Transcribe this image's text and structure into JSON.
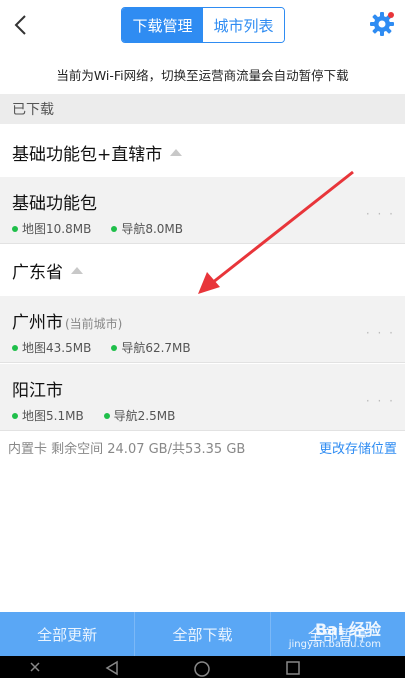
{
  "header": {
    "tabs": [
      {
        "label": "下载管理",
        "active": true
      },
      {
        "label": "城市列表",
        "active": false
      }
    ]
  },
  "notice": "当前为Wi-Fi网络，切换至运营商流量会自动暂停下载",
  "downloaded_label": "已下载",
  "groups": [
    {
      "name": "基础功能包+直辖市",
      "items": [
        {
          "name": "基础功能包",
          "sub": "",
          "map": "地图10.8MB",
          "nav": "导航8.0MB"
        }
      ]
    },
    {
      "name": "广东省",
      "items": [
        {
          "name": "广州市",
          "sub": "(当前城市)",
          "map": "地图43.5MB",
          "nav": "导航62.7MB"
        },
        {
          "name": "阳江市",
          "sub": "",
          "map": "地图5.1MB",
          "nav": "导航2.5MB"
        }
      ]
    }
  ],
  "storage": {
    "info": "内置卡 剩余空间 24.07 GB/共53.35 GB",
    "change_link": "更改存储位置"
  },
  "bottom_actions": {
    "update_all": "全部更新",
    "download_all": "全部下载",
    "pause_all": "全部暂停"
  },
  "watermark": {
    "brand": "Bai 经验",
    "url": "jingyan.baidu.com"
  },
  "colors": {
    "accent": "#2f8cf2",
    "bottom_bar": "#5aa7f5",
    "status_dot": "#1fbf4a",
    "arrow": "#e8353a"
  },
  "icons": {
    "back": "chevron-left-icon",
    "settings": "gear-icon",
    "more": "more-dots-icon"
  }
}
